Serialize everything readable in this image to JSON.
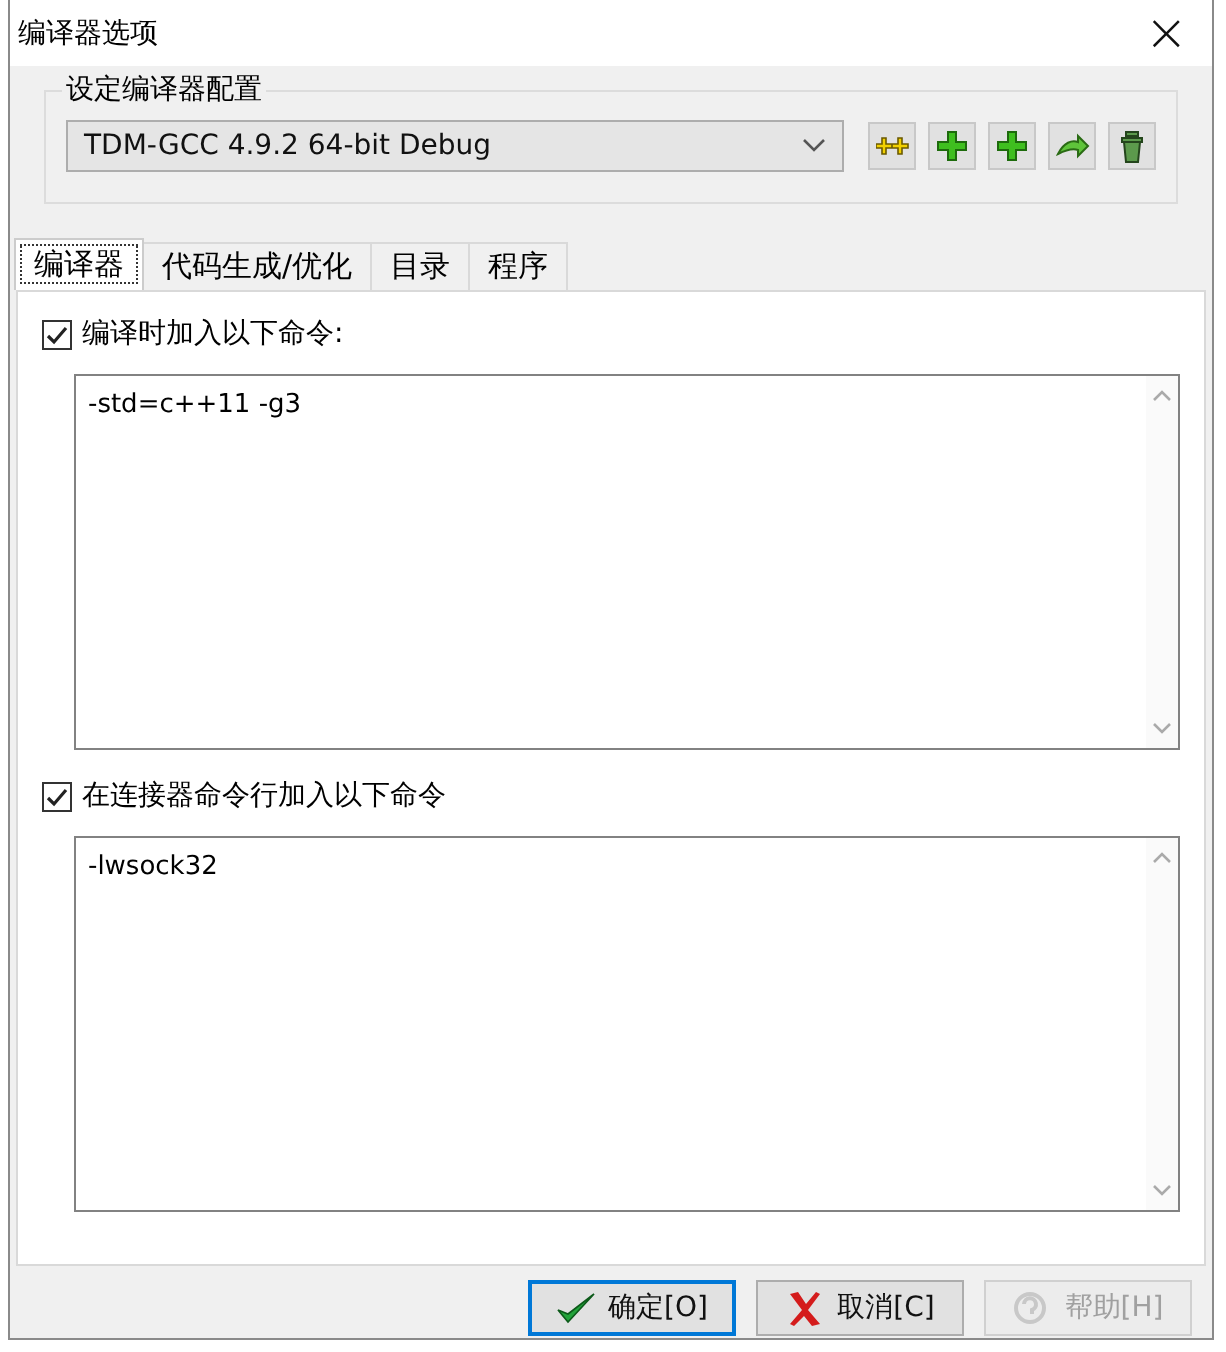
{
  "window": {
    "title": "编译器选项",
    "close": "×"
  },
  "config": {
    "legend": "设定编译器配置",
    "selected_profile": "TDM-GCC 4.9.2 64-bit Debug"
  },
  "toolbar": [
    {
      "kind": "rename"
    },
    {
      "kind": "add"
    },
    {
      "kind": "add"
    },
    {
      "kind": "export"
    },
    {
      "kind": "delete"
    }
  ],
  "tabs": [
    {
      "label": "编译器",
      "selected": true
    },
    {
      "label": "代码生成/优化",
      "selected": false
    },
    {
      "label": "目录",
      "selected": false
    },
    {
      "label": "程序",
      "selected": false
    }
  ],
  "sections": [
    {
      "label": "编译时加入以下命令:",
      "checked": true,
      "value": "-std=c++11 -g3"
    },
    {
      "label": "在连接器命令行加入以下命令",
      "checked": true,
      "value": "-lwsock32"
    }
  ],
  "buttons": [
    {
      "kind": "ok",
      "label": "确定[O]",
      "disabled": false
    },
    {
      "kind": "cancel",
      "label": "取消[C]",
      "disabled": false
    },
    {
      "kind": "help",
      "label": "帮助[H]",
      "disabled": true
    }
  ]
}
